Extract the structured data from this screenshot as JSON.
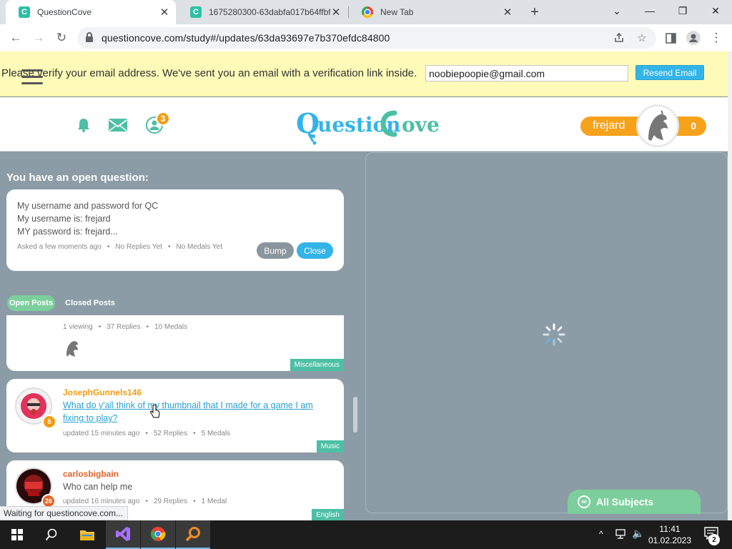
{
  "browser": {
    "tabs": [
      {
        "title": "QuestionCove",
        "close": "✕"
      },
      {
        "title": "1675280300-63dabfa017b64ffbf",
        "close": "✕"
      },
      {
        "title": "New Tab",
        "close": "✕"
      }
    ],
    "new_tab": "+",
    "window_controls": {
      "dropdown": "⌄",
      "minimize": "—",
      "restore": "❐",
      "close": "✕"
    },
    "nav": {
      "back": "←",
      "forward": "→",
      "reload": "↻"
    },
    "url": "questioncove.com/study#/updates/63da93697e7b370efdc84800",
    "status_text": "Waiting for questioncove.com..."
  },
  "verify_banner": {
    "message": "Please verify your email address. We've sent you an email with a verification link inside.",
    "email_value": "noobiepoopie@gmail.com",
    "resend_label": "Resend Email"
  },
  "header": {
    "notifications_count": "3",
    "logo_text": "QuestionCove",
    "username": "frejard",
    "score": "0"
  },
  "open_question": {
    "heading": "You have an open question:",
    "lines": [
      "My username and password for QC",
      "My username is: frejard",
      "MY password is: frejard..."
    ],
    "asked": "Asked a few moments ago",
    "replies": "No Replies Yet",
    "medals": "No Medals Yet",
    "bump_label": "Bump",
    "close_label": "Close"
  },
  "post_tabs": {
    "open": "Open Posts",
    "closed": "Closed Posts"
  },
  "posts": [
    {
      "viewing": "1 viewing",
      "replies": "37 Replies",
      "medals": "10 Medals",
      "subject": "Miscellaneous"
    },
    {
      "user": "JosephGunnels146",
      "level": "5",
      "title": "What do y'all think of my thumbnail that I made for a game I am fixing to play?",
      "updated": "updated 15 minutes ago",
      "replies": "52 Replies",
      "medals": "5 Medals",
      "subject": "Music"
    },
    {
      "user": "carlosbigbain",
      "level": "26",
      "title": "Who can help me",
      "updated": "updated 16 minutes ago",
      "replies": "29 Replies",
      "medals": "1 Medal",
      "subject": "English"
    }
  ],
  "right_panel": {
    "all_subjects_label": "All Subjects"
  },
  "taskbar": {
    "time": "11:41",
    "date": "01.02.2023",
    "notification_count": "2",
    "tray_chevron": "^",
    "volume_icon": "🔈"
  }
}
